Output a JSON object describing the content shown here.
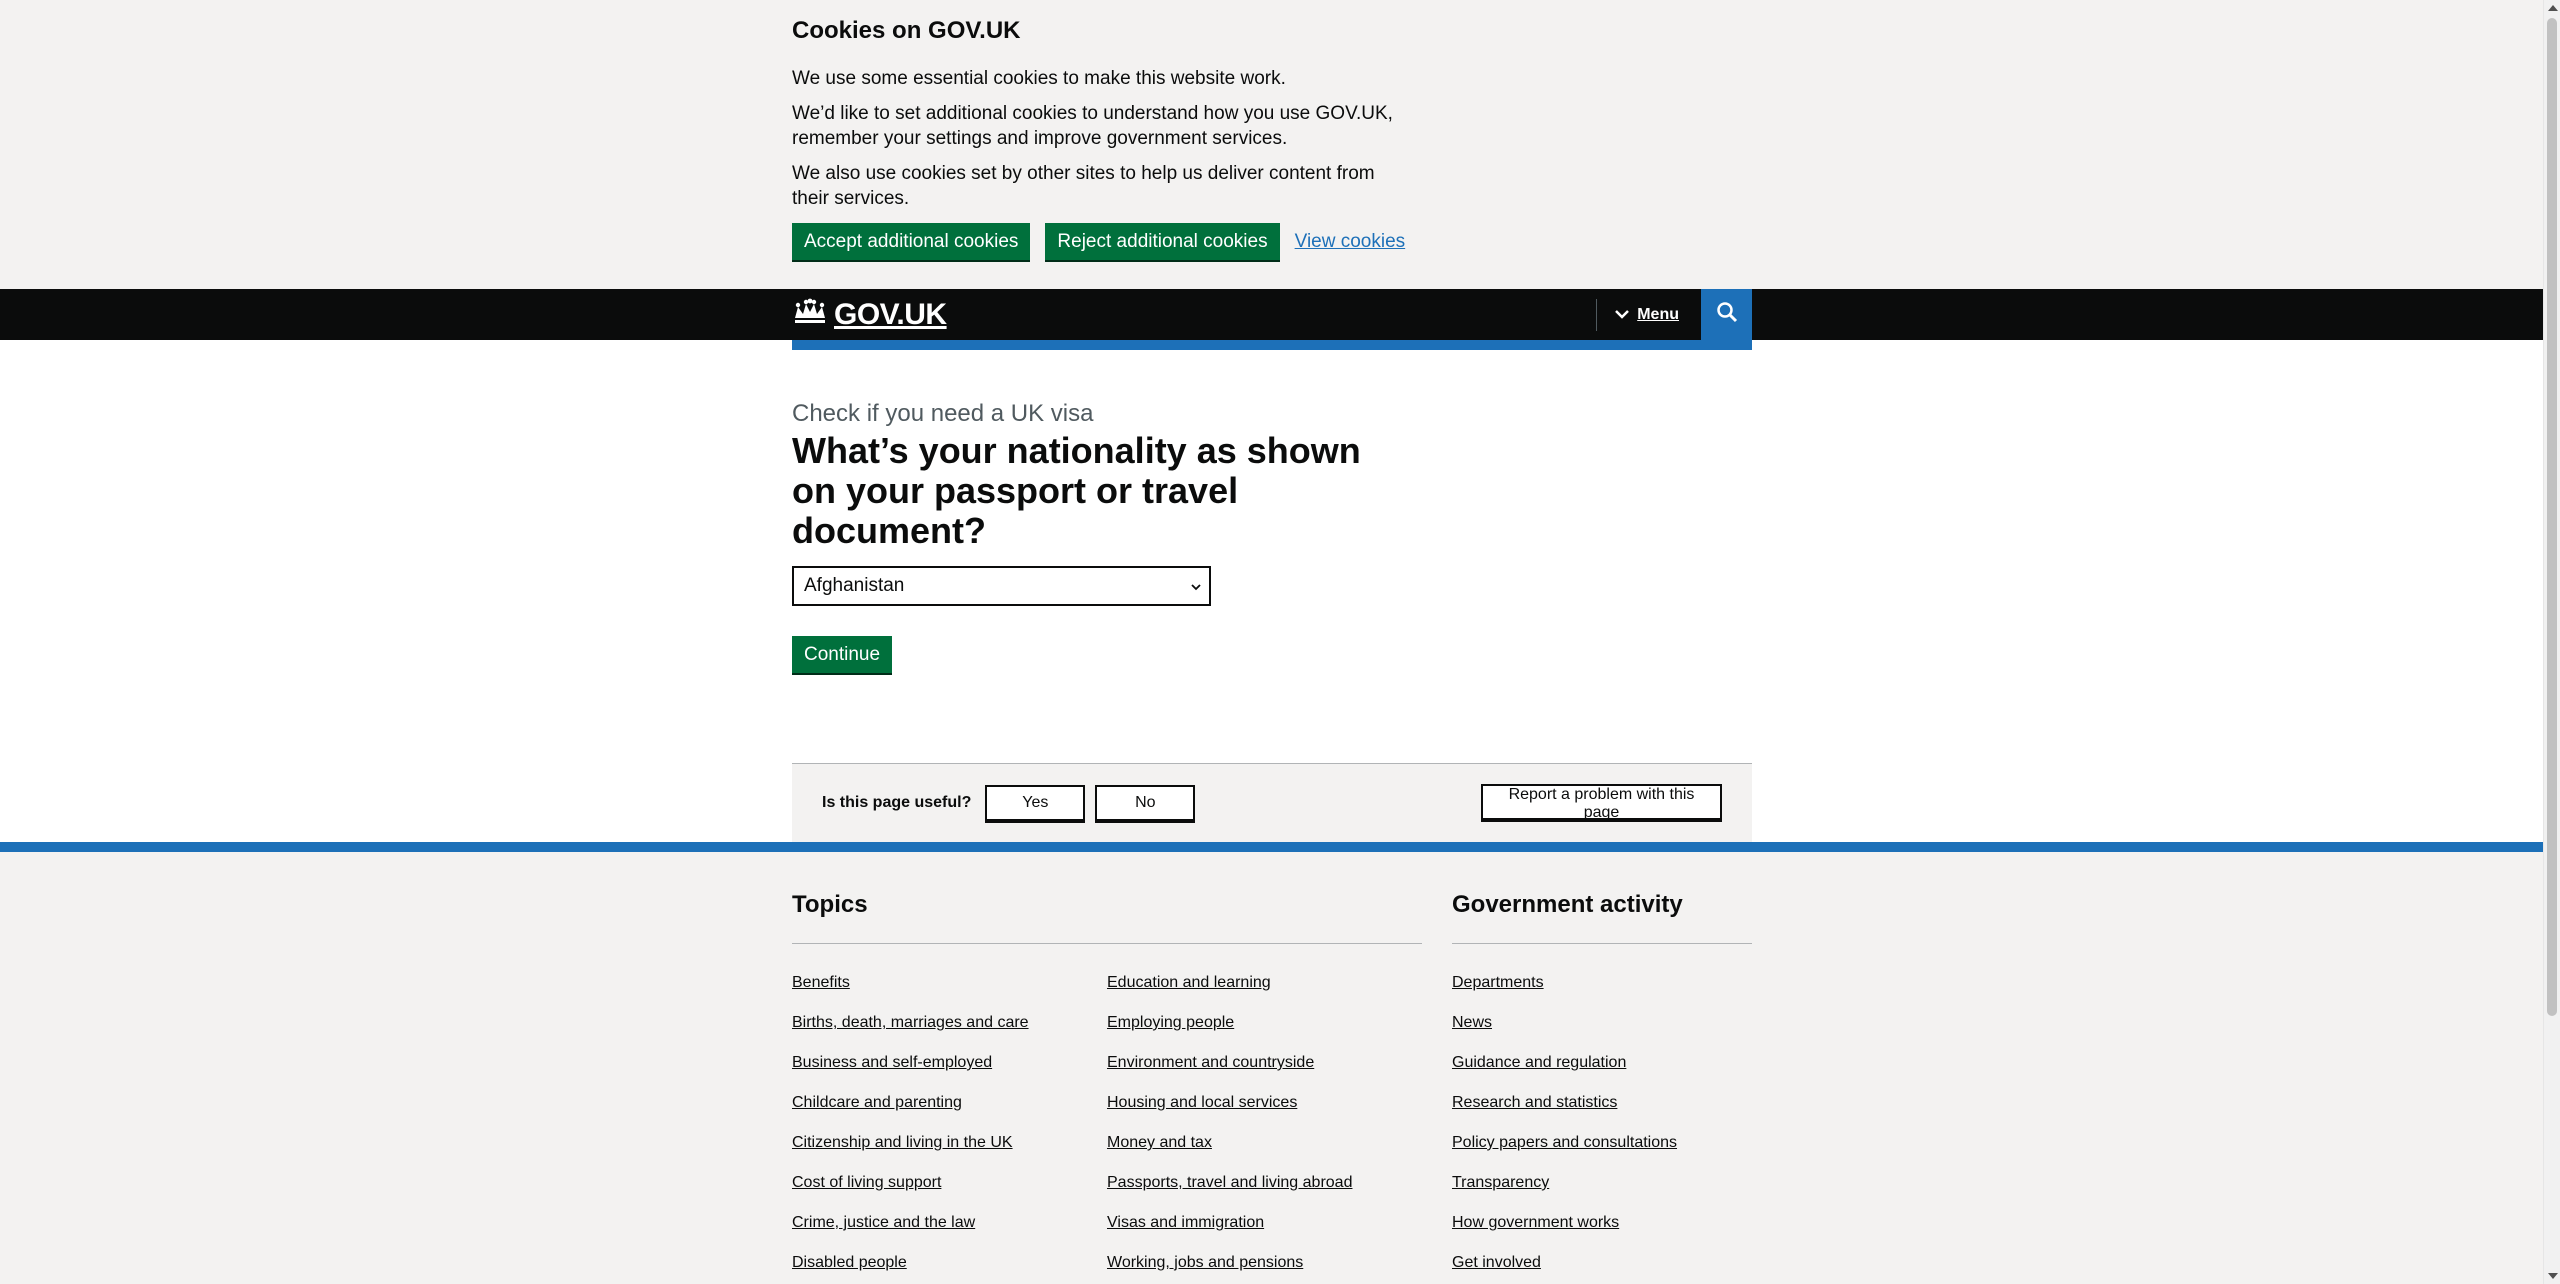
{
  "cookie_banner": {
    "title": "Cookies on GOV.UK",
    "paragraphs": [
      "We use some essential cookies to make this website work.",
      "We’d like to set additional cookies to understand how you use GOV.UK, remember your settings and improve government services.",
      "We also use cookies set by other sites to help us deliver content from their services."
    ],
    "accept_label": "Accept additional cookies",
    "reject_label": "Reject additional cookies",
    "view_label": "View cookies"
  },
  "header": {
    "logo_text": "GOV.UK",
    "menu_label": "Menu",
    "search_icon": "search-icon",
    "crown_icon": "crown-icon"
  },
  "main": {
    "caption": "Check if you need a UK visa",
    "heading": "What’s your nationality as shown on your passport or travel document?",
    "select_value": "Afghanistan",
    "continue_label": "Continue"
  },
  "feedback": {
    "question": "Is this page useful?",
    "yes_label": "Yes",
    "no_label": "No",
    "report_label": "Report a problem with this page"
  },
  "footer": {
    "topics_title": "Topics",
    "topics_col1": [
      "Benefits",
      "Births, death, marriages and care",
      "Business and self-employed",
      "Childcare and parenting",
      "Citizenship and living in the UK",
      "Cost of living support",
      "Crime, justice and the law",
      "Disabled people"
    ],
    "topics_col2": [
      "Education and learning",
      "Employing people",
      "Environment and countryside",
      "Housing and local services",
      "Money and tax",
      "Passports, travel and living abroad",
      "Visas and immigration",
      "Working, jobs and pensions"
    ],
    "gov_title": "Government activity",
    "gov_links": [
      "Departments",
      "News",
      "Guidance and regulation",
      "Research and statistics",
      "Policy papers and consultations",
      "Transparency",
      "How government works",
      "Get involved"
    ]
  },
  "colors": {
    "brand_green": "#00703c",
    "brand_blue": "#1d70b8",
    "header_black": "#0b0c0c",
    "panel_grey": "#f3f2f1"
  }
}
